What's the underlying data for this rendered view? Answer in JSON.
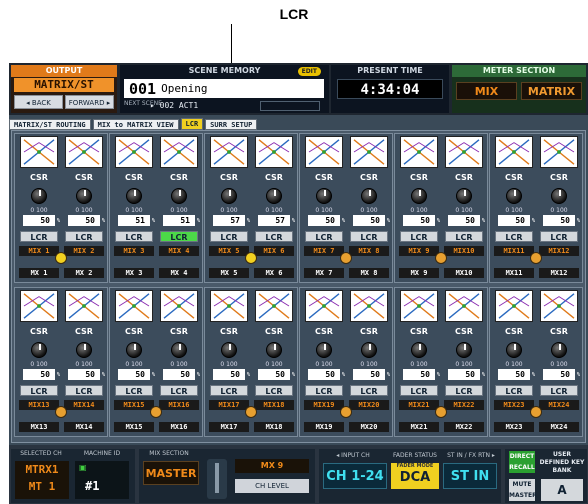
{
  "callout": "LCR",
  "header": {
    "output": {
      "title": "OUTPUT",
      "value": "MATRIX/ST",
      "back": "◂ BACK",
      "forward": "FORWARD ▸"
    },
    "scene": {
      "title": "SCENE MEMORY",
      "edit": "EDIT",
      "number": "001",
      "name": "Opening",
      "next_label": "NEXT SCENE",
      "next_value": "▸ 002 ACT1"
    },
    "time": {
      "title": "PRESENT TIME",
      "value": "4:34:04"
    },
    "meter": {
      "title": "METER SECTION",
      "mix": "MIX",
      "matrix": "MATRIX"
    }
  },
  "tabs": [
    "MATRIX/ST ROUTING",
    "MIX to MATRIX VIEW",
    "LCR",
    "SURR SETUP"
  ],
  "channel_common": {
    "csr": "CSR",
    "scale_min": "0",
    "scale_max": "100",
    "lcr": "LCR",
    "percent_sign": "%"
  },
  "rows": [
    {
      "pairs": [
        {
          "ch": [
            {
              "mix": "MIX 1",
              "mx": "MX 1",
              "value": "50",
              "lcr_on": false
            },
            {
              "mix": "MIX 2",
              "mx": "MX 2",
              "value": "50",
              "lcr_on": false
            }
          ],
          "link": "gold"
        },
        {
          "ch": [
            {
              "mix": "MIX 3",
              "mx": "MX 3",
              "value": "51",
              "lcr_on": false
            },
            {
              "mix": "MIX 4",
              "mx": "MX 4",
              "value": "51",
              "lcr_on": true
            }
          ],
          "link": "none"
        },
        {
          "ch": [
            {
              "mix": "MIX 5",
              "mx": "MX 5",
              "value": "57",
              "lcr_on": false
            },
            {
              "mix": "MIX 6",
              "mx": "MX 6",
              "value": "57",
              "lcr_on": false
            }
          ],
          "link": "gold"
        },
        {
          "ch": [
            {
              "mix": "MIX 7",
              "mx": "MX 7",
              "value": "50",
              "lcr_on": false
            },
            {
              "mix": "MIX 8",
              "mx": "MX 8",
              "value": "50",
              "lcr_on": false
            }
          ],
          "link": "orange"
        },
        {
          "ch": [
            {
              "mix": "MIX 9",
              "mx": "MX 9",
              "value": "50",
              "lcr_on": false
            },
            {
              "mix": "MIX10",
              "mx": "MX10",
              "value": "50",
              "lcr_on": false
            }
          ],
          "link": "orange"
        },
        {
          "ch": [
            {
              "mix": "MIX11",
              "mx": "MX11",
              "value": "50",
              "lcr_on": false
            },
            {
              "mix": "MIX12",
              "mx": "MX12",
              "value": "50",
              "lcr_on": false
            }
          ],
          "link": "orange"
        }
      ]
    },
    {
      "pairs": [
        {
          "ch": [
            {
              "mix": "MIX13",
              "mx": "MX13",
              "value": "50",
              "lcr_on": false
            },
            {
              "mix": "MIX14",
              "mx": "MX14",
              "value": "50",
              "lcr_on": false
            }
          ],
          "link": "orange"
        },
        {
          "ch": [
            {
              "mix": "MIX15",
              "mx": "MX15",
              "value": "50",
              "lcr_on": false
            },
            {
              "mix": "MIX16",
              "mx": "MX16",
              "value": "50",
              "lcr_on": false
            }
          ],
          "link": "orange"
        },
        {
          "ch": [
            {
              "mix": "MIX17",
              "mx": "MX17",
              "value": "50",
              "lcr_on": false
            },
            {
              "mix": "MIX18",
              "mx": "MX18",
              "value": "50",
              "lcr_on": false
            }
          ],
          "link": "orange"
        },
        {
          "ch": [
            {
              "mix": "MIX19",
              "mx": "MX19",
              "value": "50",
              "lcr_on": false
            },
            {
              "mix": "MIX20",
              "mx": "MX20",
              "value": "50",
              "lcr_on": false
            }
          ],
          "link": "orange"
        },
        {
          "ch": [
            {
              "mix": "MIX21",
              "mx": "MX21",
              "value": "50",
              "lcr_on": false
            },
            {
              "mix": "MIX22",
              "mx": "MX22",
              "value": "50",
              "lcr_on": false
            }
          ],
          "link": "orange"
        },
        {
          "ch": [
            {
              "mix": "MIX23",
              "mx": "MX23",
              "value": "50",
              "lcr_on": false
            },
            {
              "mix": "MIX24",
              "mx": "MX24",
              "value": "50",
              "lcr_on": false
            }
          ],
          "link": "orange"
        }
      ]
    }
  ],
  "footer": {
    "selected_title": "SELECTED CH",
    "selected_value_1": "MTRX1",
    "selected_value_2": "MT 1",
    "machine_title": "MACHINE ID",
    "machine_value": "#1",
    "mix_section_title": "MIX SECTION",
    "master": "MASTER",
    "mix9": "MX 9",
    "ch_level": "CH LEVEL",
    "input_ch_title": "◂ INPUT CH",
    "fader_status_title": "FADER STATUS",
    "st_in_title": "ST IN / FX RTN ▸",
    "ch_1_24": "CH 1-24",
    "fader_mode": "FADER MODE",
    "dca": "DCA",
    "st_in": "ST IN",
    "direct_recall": "DIRECT RECALL",
    "mute_master": "MUTE MASTER",
    "user_key_bank": "USER DEFINED KEY BANK",
    "bank": "A"
  },
  "colors": {
    "accent_orange": "#f08a1a",
    "lcr_on": "#4cd848",
    "fader_cyan": "#40e0f0",
    "dca_yellow": "#f0d020"
  }
}
